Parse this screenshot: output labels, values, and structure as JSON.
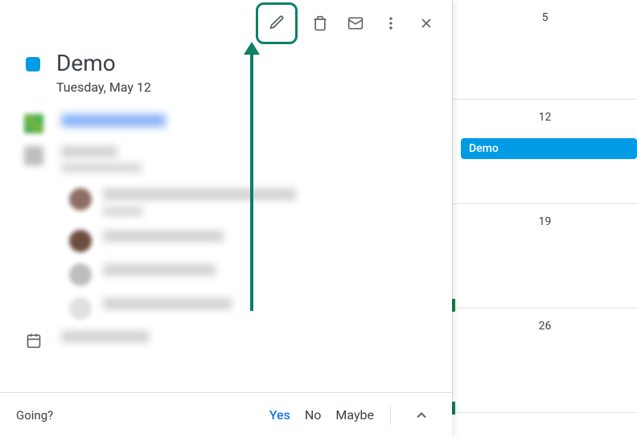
{
  "event": {
    "title": "Demo",
    "date": "Tuesday, May 12"
  },
  "rsvp": {
    "label": "Going?",
    "yes": "Yes",
    "no": "No",
    "maybe": "Maybe"
  },
  "calendar": {
    "dates": [
      "5",
      "12",
      "19",
      "26"
    ],
    "event_label": "Demo"
  },
  "colors": {
    "event_color": "#039be5",
    "highlight": "#0d8066"
  }
}
